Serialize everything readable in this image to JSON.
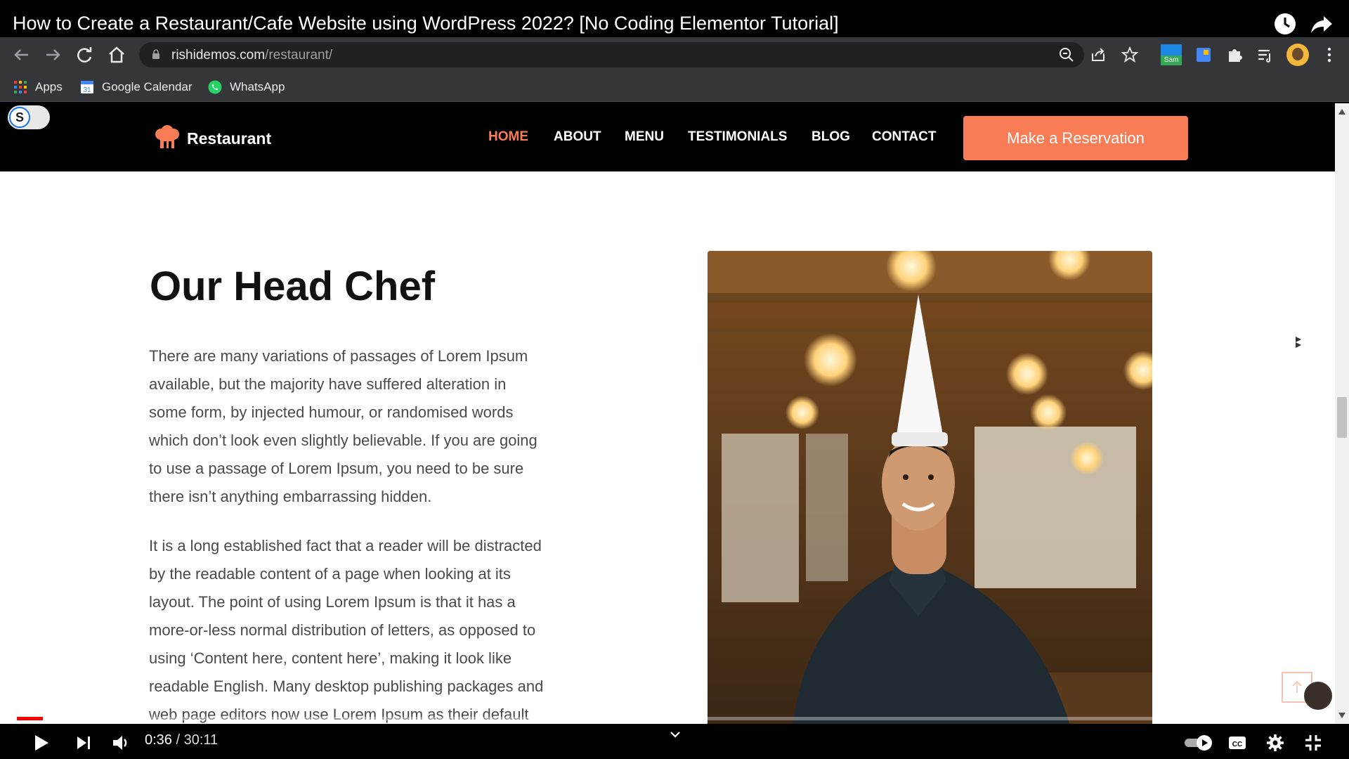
{
  "video": {
    "title": "How to Create a Restaurant/Cafe Website using WordPress 2022? [No Coding Elementor Tutorial]",
    "current_time": "0:36",
    "time_separator": " / ",
    "duration": "30:11",
    "progress_fraction": 0.02,
    "buffered_fraction": 0.066
  },
  "browser": {
    "url_host": "rishidemos.com",
    "url_path": "/restaurant/",
    "extension_badge": "Sam"
  },
  "bookmarks": [
    {
      "label": "Apps",
      "icon": "apps-grid-icon"
    },
    {
      "label": "Google Calendar",
      "icon": "calendar-icon"
    },
    {
      "label": "WhatsApp",
      "icon": "whatsapp-icon"
    }
  ],
  "page_extension_toggle": {
    "letter": "S"
  },
  "site": {
    "logo_text": "Restaurant",
    "nav": [
      "HOME",
      "ABOUT",
      "MENU",
      "TESTIMONIALS",
      "BLOG",
      "CONTACT"
    ],
    "active_nav": "HOME",
    "cta_label": "Make a Reservation",
    "accent_color": "#f87c56"
  },
  "content": {
    "heading": "Our Head Chef",
    "paragraph1_lines": [
      "There are many variations of passages of Lorem Ipsum",
      "available, but the majority have suffered alteration in",
      "some form, by injected humour, or randomised words",
      "which don’t look even slightly believable. If you are going",
      "to use a passage of Lorem Ipsum, you need to be sure",
      "there isn’t anything embarrassing hidden."
    ],
    "paragraph2_lines": [
      "It is a long established fact that a reader will be distracted",
      "by the readable content of a page when looking at its",
      "layout. The point of using Lorem Ipsum is that it has a",
      "more-or-less normal distribution of letters, as opposed to",
      "using ‘Content here, content here’, making it look like",
      "readable English. Many desktop publishing packages and",
      "web page editors now use Lorem Ipsum as their default"
    ],
    "photo_subject": "chef-portrait-photo"
  }
}
